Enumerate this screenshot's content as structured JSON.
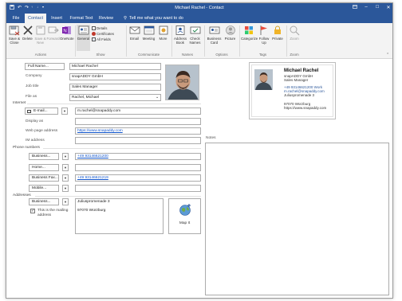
{
  "window": {
    "title": "Michael Rachel  -  Contact"
  },
  "tabs": [
    {
      "label": "File"
    },
    {
      "label": "Contact"
    },
    {
      "label": "Insert"
    },
    {
      "label": "Format Text"
    },
    {
      "label": "Review"
    }
  ],
  "tell_me": "Tell me what you want to do",
  "ribbon": {
    "actions": {
      "save_close": "Save & Close",
      "delete": "Delete",
      "save_new": "Save & New",
      "forward": "Forward",
      "onenote": "OneNote",
      "group": "Actions"
    },
    "show": {
      "general": "General",
      "details": "Details",
      "certificates": "Certificates",
      "all_fields": "All Fields",
      "group": "Show"
    },
    "communicate": {
      "email": "Email",
      "meeting": "Meeting",
      "more": "More",
      "group": "Communicate"
    },
    "names": {
      "address_book": "Address Book",
      "check_names": "Check Names",
      "group": "Names"
    },
    "options": {
      "business_card": "Business Card",
      "picture": "Picture",
      "group": "Options"
    },
    "tags": {
      "categorize": "Categorize",
      "follow_up": "Follow Up",
      "private": "Private",
      "group": "Tags"
    },
    "zoom": {
      "zoom": "Zoom",
      "group": "Zoom"
    }
  },
  "form": {
    "full_name_btn": "Full Name...",
    "full_name": "Michael Rachel",
    "company_label": "Company",
    "company": "snapADDY GmbH",
    "job_title_label": "Job title",
    "job_title": "Sales Manager",
    "file_as_label": "File as",
    "file_as": "Rachel, Michael",
    "internet_label": "Internet",
    "email_btn": "E-mail...",
    "email": "m.rachel@snapaddy.com",
    "display_as_label": "Display as",
    "display_as": "",
    "web_label": "Web page address",
    "web": "https://www.snapaddy.com",
    "im_label": "IM address",
    "im": "",
    "phone_label": "Phone numbers",
    "phones": [
      {
        "type": "Business...",
        "value": "+49 93146621200"
      },
      {
        "type": "Home...",
        "value": ""
      },
      {
        "type": "Business Fax...",
        "value": "+49 93146621219"
      },
      {
        "type": "Mobile...",
        "value": ""
      }
    ],
    "addresses_label": "Addresses",
    "address_type": "Business...",
    "address_line1": "Juliuspromenade 3",
    "address_line2": "97070  Würzburg",
    "mailing_checkbox": "This is the mailing address",
    "map_it": "Map It",
    "notes_label": "Notes"
  },
  "card": {
    "name": "Michael Rachel",
    "company": "snapADDY GmbH",
    "title": "Sales Manager",
    "phone": "+49 93146621200 Work",
    "email": "m.rachel@snapaddy.com",
    "street": "Juliuspromenade 3",
    "city": "97070  Würzburg",
    "web": "https://www.snapaddy.com"
  },
  "colors": {
    "accent": "#2b579a",
    "link": "#1155cc"
  }
}
